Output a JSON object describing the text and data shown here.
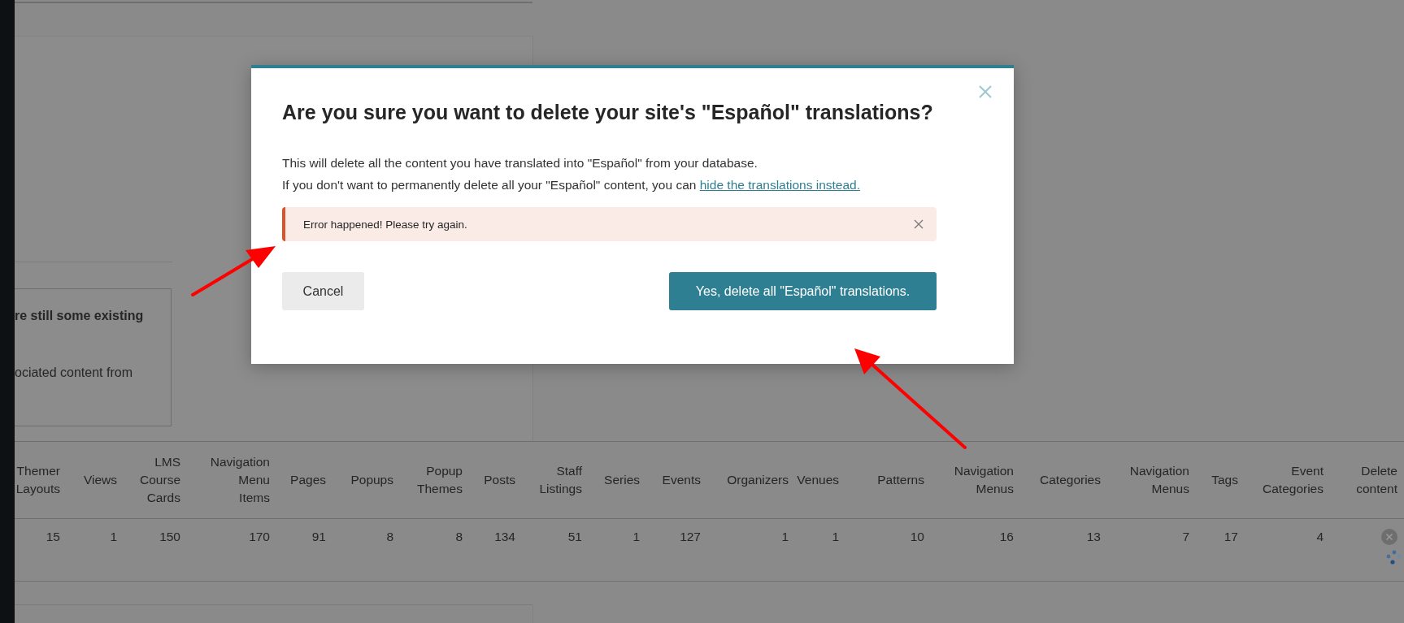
{
  "background_page": {
    "notice": {
      "heading": "re still some existing",
      "text": "ociated content from"
    }
  },
  "table": {
    "columns": [
      "Themer Layouts",
      "Views",
      "LMS Course Cards",
      "Navigation Menu Items",
      "Pages",
      "Popups",
      "Popup Themes",
      "Posts",
      "Staff Listings",
      "Series",
      "Events",
      "Organizers",
      "Venues",
      "Patterns",
      "Navigation Menus",
      "Categories",
      "Navigation Menus",
      "Tags",
      "Event Categories",
      "Delete content"
    ],
    "rows": [
      {
        "cells": [
          "15",
          "1",
          "150",
          "170",
          "91",
          "8",
          "8",
          "134",
          "51",
          "1",
          "127",
          "1",
          "1",
          "10",
          "16",
          "13",
          "7",
          "17",
          "4"
        ],
        "loading": true
      }
    ]
  },
  "dialog": {
    "title": "Are you sure you want to delete your site's \"Español\" translations?",
    "body_line_1": "This will delete all the content you have translated into \"Español\" from your database.",
    "body_line_2": "If you don't want to permanently delete all your \"Español\" content, you can ",
    "link": "hide the translations instead.",
    "error": {
      "message": "Error happened! Please try again."
    },
    "cancel": "Cancel",
    "confirm": "Yes, delete all \"Español\" translations."
  }
}
